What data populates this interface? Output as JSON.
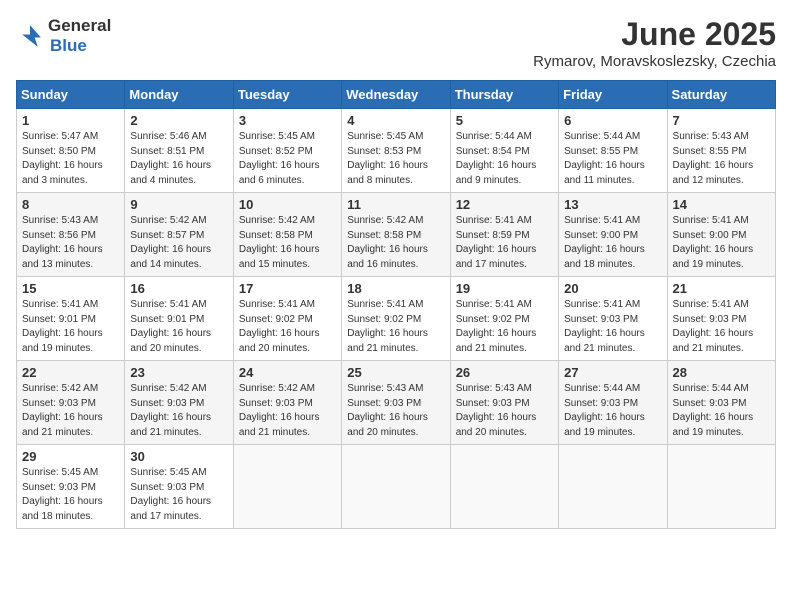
{
  "header": {
    "logo_general": "General",
    "logo_blue": "Blue",
    "month_title": "June 2025",
    "subtitle": "Rymarov, Moravskoslezsky, Czechia"
  },
  "weekdays": [
    "Sunday",
    "Monday",
    "Tuesday",
    "Wednesday",
    "Thursday",
    "Friday",
    "Saturday"
  ],
  "weeks": [
    [
      {
        "day": "1",
        "sunrise": "5:47 AM",
        "sunset": "8:50 PM",
        "daylight": "16 hours and 3 minutes."
      },
      {
        "day": "2",
        "sunrise": "5:46 AM",
        "sunset": "8:51 PM",
        "daylight": "16 hours and 4 minutes."
      },
      {
        "day": "3",
        "sunrise": "5:45 AM",
        "sunset": "8:52 PM",
        "daylight": "16 hours and 6 minutes."
      },
      {
        "day": "4",
        "sunrise": "5:45 AM",
        "sunset": "8:53 PM",
        "daylight": "16 hours and 8 minutes."
      },
      {
        "day": "5",
        "sunrise": "5:44 AM",
        "sunset": "8:54 PM",
        "daylight": "16 hours and 9 minutes."
      },
      {
        "day": "6",
        "sunrise": "5:44 AM",
        "sunset": "8:55 PM",
        "daylight": "16 hours and 11 minutes."
      },
      {
        "day": "7",
        "sunrise": "5:43 AM",
        "sunset": "8:55 PM",
        "daylight": "16 hours and 12 minutes."
      }
    ],
    [
      {
        "day": "8",
        "sunrise": "5:43 AM",
        "sunset": "8:56 PM",
        "daylight": "16 hours and 13 minutes."
      },
      {
        "day": "9",
        "sunrise": "5:42 AM",
        "sunset": "8:57 PM",
        "daylight": "16 hours and 14 minutes."
      },
      {
        "day": "10",
        "sunrise": "5:42 AM",
        "sunset": "8:58 PM",
        "daylight": "16 hours and 15 minutes."
      },
      {
        "day": "11",
        "sunrise": "5:42 AM",
        "sunset": "8:58 PM",
        "daylight": "16 hours and 16 minutes."
      },
      {
        "day": "12",
        "sunrise": "5:41 AM",
        "sunset": "8:59 PM",
        "daylight": "16 hours and 17 minutes."
      },
      {
        "day": "13",
        "sunrise": "5:41 AM",
        "sunset": "9:00 PM",
        "daylight": "16 hours and 18 minutes."
      },
      {
        "day": "14",
        "sunrise": "5:41 AM",
        "sunset": "9:00 PM",
        "daylight": "16 hours and 19 minutes."
      }
    ],
    [
      {
        "day": "15",
        "sunrise": "5:41 AM",
        "sunset": "9:01 PM",
        "daylight": "16 hours and 19 minutes."
      },
      {
        "day": "16",
        "sunrise": "5:41 AM",
        "sunset": "9:01 PM",
        "daylight": "16 hours and 20 minutes."
      },
      {
        "day": "17",
        "sunrise": "5:41 AM",
        "sunset": "9:02 PM",
        "daylight": "16 hours and 20 minutes."
      },
      {
        "day": "18",
        "sunrise": "5:41 AM",
        "sunset": "9:02 PM",
        "daylight": "16 hours and 21 minutes."
      },
      {
        "day": "19",
        "sunrise": "5:41 AM",
        "sunset": "9:02 PM",
        "daylight": "16 hours and 21 minutes."
      },
      {
        "day": "20",
        "sunrise": "5:41 AM",
        "sunset": "9:03 PM",
        "daylight": "16 hours and 21 minutes."
      },
      {
        "day": "21",
        "sunrise": "5:41 AM",
        "sunset": "9:03 PM",
        "daylight": "16 hours and 21 minutes."
      }
    ],
    [
      {
        "day": "22",
        "sunrise": "5:42 AM",
        "sunset": "9:03 PM",
        "daylight": "16 hours and 21 minutes."
      },
      {
        "day": "23",
        "sunrise": "5:42 AM",
        "sunset": "9:03 PM",
        "daylight": "16 hours and 21 minutes."
      },
      {
        "day": "24",
        "sunrise": "5:42 AM",
        "sunset": "9:03 PM",
        "daylight": "16 hours and 21 minutes."
      },
      {
        "day": "25",
        "sunrise": "5:43 AM",
        "sunset": "9:03 PM",
        "daylight": "16 hours and 20 minutes."
      },
      {
        "day": "26",
        "sunrise": "5:43 AM",
        "sunset": "9:03 PM",
        "daylight": "16 hours and 20 minutes."
      },
      {
        "day": "27",
        "sunrise": "5:44 AM",
        "sunset": "9:03 PM",
        "daylight": "16 hours and 19 minutes."
      },
      {
        "day": "28",
        "sunrise": "5:44 AM",
        "sunset": "9:03 PM",
        "daylight": "16 hours and 19 minutes."
      }
    ],
    [
      {
        "day": "29",
        "sunrise": "5:45 AM",
        "sunset": "9:03 PM",
        "daylight": "16 hours and 18 minutes."
      },
      {
        "day": "30",
        "sunrise": "5:45 AM",
        "sunset": "9:03 PM",
        "daylight": "16 hours and 17 minutes."
      },
      null,
      null,
      null,
      null,
      null
    ]
  ],
  "labels": {
    "sunrise": "Sunrise:",
    "sunset": "Sunset:",
    "daylight": "Daylight:"
  }
}
